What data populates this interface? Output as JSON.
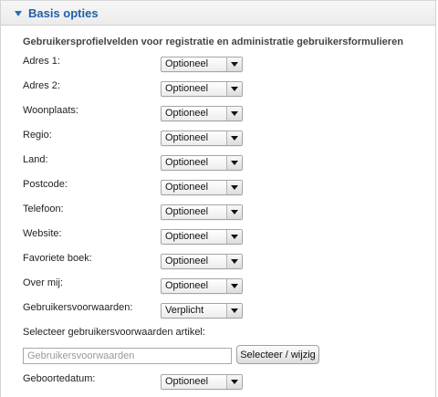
{
  "panel": {
    "title": "Basis opties",
    "section_heading": "Gebruikersprofielvelden voor registratie en administratie gebruikersformulieren"
  },
  "fields": [
    {
      "label": "Adres 1:",
      "value": "Optioneel"
    },
    {
      "label": "Adres 2:",
      "value": "Optioneel"
    },
    {
      "label": "Woonplaats:",
      "value": "Optioneel"
    },
    {
      "label": "Regio:",
      "value": "Optioneel"
    },
    {
      "label": "Land:",
      "value": "Optioneel"
    },
    {
      "label": "Postcode:",
      "value": "Optioneel"
    },
    {
      "label": "Telefoon:",
      "value": "Optioneel"
    },
    {
      "label": "Website:",
      "value": "Optioneel"
    },
    {
      "label": "Favoriete boek:",
      "value": "Optioneel"
    },
    {
      "label": "Over mij:",
      "value": "Optioneel"
    },
    {
      "label": "Gebruikersvoorwaarden:",
      "value": "Verplicht"
    }
  ],
  "terms_article": {
    "label": "Selecteer gebruikersvoorwaarden artikel:",
    "input_placeholder": "Gebruikersvoorwaarden",
    "button_label": "Selecteer / wijzig"
  },
  "birthdate": {
    "label": "Geboortedatum:",
    "value": "Optioneel"
  },
  "icons": {
    "toggle": "collapse-triangle-icon",
    "select_arrow": "chevron-down-icon"
  },
  "colors": {
    "title_accent": "#1f5fa8",
    "toggle_icon": "#2a6fb4"
  }
}
